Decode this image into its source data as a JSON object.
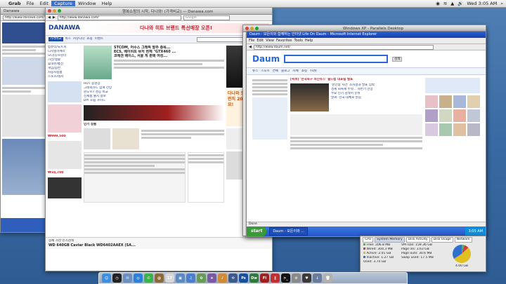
{
  "menubar": {
    "apple": "",
    "app": "Grab",
    "items": [
      "File",
      "Edit",
      "Capture",
      "Window",
      "Help"
    ],
    "selected": "Capture",
    "clock": "Wed 3:05 AM",
    "status": [
      "◉",
      "≋",
      "▲",
      "🔊"
    ]
  },
  "left_window": {
    "title": "Danawa",
    "url": "http://www.danawa.com/",
    "tabs": [
      "Danawa"
    ]
  },
  "main_window": {
    "title": "행복쇼핑의 시작, 다나와! (가격비교) — Danawa.com",
    "url": "http://www.danawa.com/",
    "search_placeholder": "Google",
    "logo": "DANAWA",
    "banner_ad": "다나와 히트 브랜드 특선매장 오픈!",
    "nav": [
      "가격비교",
      "뉴스",
      "커뮤니티",
      "쇼핑",
      "이벤트"
    ],
    "search_btn": "검색",
    "category_list": [
      "컴퓨터/노트북",
      "디지털카메라",
      "모니터/프린터",
      "가전/생활",
      "휴대폰/통신",
      "게임/음반",
      "자동차용품",
      "스포츠/레저"
    ],
    "headline": "STCOM, 어수스 그래픽 발주 총욕...",
    "headline2": "ECS, 베이비트 뮤저 현재 \"GTX460 ...",
    "headline3": "코에센 베이스, 서울 게 판매 여성...",
    "news_items": [
      "HOT 동영상",
      "그래픽카드 업계 전망",
      "윈도우7 성능 비교",
      "신제품 출시 정보",
      "DIY 조립 가이드"
    ],
    "promo_right": "다나와 오버클러킹 챌린지 2010 도전하세요!",
    "price": "₩999,500",
    "price2": "₩34,700",
    "section_title": "인기 상품",
    "bottom_item": "WD 640GB Caviar Black WD6402AAEX (SA...",
    "spec_label": "상세 가산 인기검색"
  },
  "ie_window": {
    "title": "Daum - 모든이와 함께하는 인터넷 Life On Daum - Microsoft Internet Explorer",
    "url": "http://www.daum.net/",
    "menu": [
      "File",
      "Edit",
      "View",
      "Favorites",
      "Tools",
      "Help"
    ],
    "logo": "Daum",
    "search_btn": "검색",
    "tabs": [
      "뉴스",
      "스포츠",
      "연예",
      "블로그",
      "카페",
      "쇼핑",
      "TV팟"
    ],
    "headline": "[속보] '한국축구 최신뉴스' 월드컵 대표팀 발표",
    "news": [
      "'천안함 사건' 조사결과 발표 임박",
      "경제 회복세 뚜렷... 하반기 전망",
      "주요 인기 검색어 순위",
      "날씨: 전국 대체로 맑음"
    ],
    "status_ready": "Done",
    "taskbar_start": "start",
    "taskbar_item": "Daum - 모든이와 ...",
    "taskbar_clock": "3:05 AM"
  },
  "parallels": {
    "title": "Windows XP - Parallels Desktop"
  },
  "activity_monitor": {
    "tabs": [
      "CPU",
      "System Memory",
      "Disk Activity",
      "Disk Usage",
      "Network"
    ],
    "rows": [
      {
        "label": "Free:",
        "value": "206.8 MB",
        "color": "#3fbf3f"
      },
      {
        "label": "Wired:",
        "value": "304.3 MB",
        "color": "#d23c3c"
      },
      {
        "label": "Active:",
        "value": "2.01 GB",
        "color": "#e0c020"
      },
      {
        "label": "Inactive:",
        "value": "1.27 GB",
        "color": "#2f6fd0"
      },
      {
        "label": "Used:",
        "value": "3.74 GB",
        "color": "#666666"
      }
    ],
    "vm": [
      {
        "label": "VM size:",
        "value": "159.36 GB"
      },
      {
        "label": "Page ins:",
        "value": "3.63 GB"
      },
      {
        "label": "Page outs:",
        "value": "30.6 MB"
      },
      {
        "label": "Swap used:",
        "value": "17.5 MB"
      }
    ],
    "pie_label": "4.00 GB",
    "pie_fractions": [
      0.05,
      0.08,
      0.53,
      0.34
    ]
  },
  "dock": [
    {
      "name": "finder",
      "color": "#3f8fe0",
      "glyph": "☺"
    },
    {
      "name": "dashboard",
      "color": "#222222",
      "glyph": "◷"
    },
    {
      "name": "mail",
      "color": "#6a8fc0",
      "glyph": "✉"
    },
    {
      "name": "safari",
      "color": "#2e7fd6",
      "glyph": "◎"
    },
    {
      "name": "ichat",
      "color": "#3bb34a",
      "glyph": "✆"
    },
    {
      "name": "address-book",
      "color": "#8a6a3a",
      "glyph": "@"
    },
    {
      "name": "ical",
      "color": "#d8d8d8",
      "glyph": "17"
    },
    {
      "name": "preview",
      "color": "#5a8ac0",
      "glyph": "▣"
    },
    {
      "name": "itunes",
      "color": "#4a7fd0",
      "glyph": "♫"
    },
    {
      "name": "iphoto",
      "color": "#6a9a5a",
      "glyph": "✿"
    },
    {
      "name": "imovie",
      "color": "#7a5aa0",
      "glyph": "★"
    },
    {
      "name": "garageband",
      "color": "#d08a3a",
      "glyph": "♪"
    },
    {
      "name": "time-machine",
      "color": "#3a5a8a",
      "glyph": "⟲"
    },
    {
      "name": "photoshop",
      "color": "#1a4fa0",
      "glyph": "Ps"
    },
    {
      "name": "dreamweaver",
      "color": "#2f7a3a",
      "glyph": "Dw"
    },
    {
      "name": "flash",
      "color": "#a02020",
      "glyph": "Fl"
    },
    {
      "name": "parallels",
      "color": "#c03030",
      "glyph": "∥"
    },
    {
      "name": "terminal",
      "color": "#111111",
      "glyph": ">_"
    },
    {
      "name": "system-preferences",
      "color": "#8a8a8a",
      "glyph": "⚙"
    },
    {
      "name": "activity-monitor",
      "color": "#3a3a3a",
      "glyph": "♥"
    },
    {
      "name": "downloads",
      "color": "#6a7a9a",
      "glyph": "↓"
    },
    {
      "name": "trash",
      "color": "#b0b0b0",
      "glyph": "🗑"
    }
  ]
}
